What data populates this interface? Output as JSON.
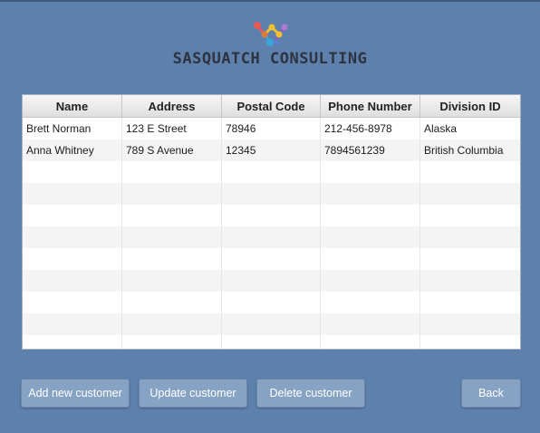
{
  "brand": {
    "name": "SASQUATCH CONSULTING",
    "logo_icon": "molecule-logo-icon",
    "colors": {
      "background": "#5e80ad",
      "button": "#87a3c4"
    }
  },
  "table": {
    "columns": [
      "Name",
      "Address",
      "Postal Code",
      "Phone Number",
      "Division ID"
    ],
    "rows": [
      [
        "Brett Norman",
        "123 E Street",
        "78946",
        "212-456-8978",
        "Alaska"
      ],
      [
        "Anna Whitney",
        "789 S Avenue",
        "12345",
        "7894561239",
        "British Columbia"
      ]
    ]
  },
  "buttons": {
    "add": "Add new customer",
    "update": "Update customer",
    "delete": "Delete customer",
    "back": "Back"
  }
}
